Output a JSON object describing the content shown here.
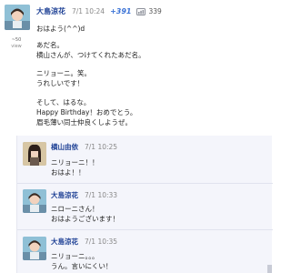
{
  "post": {
    "author": "大島涼花",
    "time": "7/1 10:24",
    "plus": "+391",
    "views": "339",
    "vote_count": "~50",
    "vote_label": "view",
    "lines": [
      "おはよう(^^)d",
      "",
      "あだ名。",
      "横山さんが、つけてくれたあだ名。",
      "",
      "ニリョーニ。笑。",
      "うれしいです！",
      "",
      "そして、はるな。",
      "Happy Birthday！おめでとう。",
      "眉毛薄い同士仲良くしようぜ。"
    ],
    "icon": "eye-icon"
  },
  "comments": [
    {
      "author": "横山由依",
      "time": "7/1 10:25",
      "lines": [
        "ニリョーニ！！",
        "おはよ！！"
      ],
      "avatar_color": "#d7c6a4"
    },
    {
      "author": "大島涼花",
      "time": "7/1 10:33",
      "lines": [
        "ニローニさん！",
        "おはようございます！"
      ],
      "avatar_color": "#9cc7da"
    },
    {
      "author": "大島涼花",
      "time": "7/1 10:35",
      "lines": [
        "ニリョーニ。。。",
        "うん。言いにくい！"
      ],
      "avatar_color": "#9cc7da"
    }
  ],
  "colors": {
    "author": "#1c3f94",
    "plus": "#3b73d6",
    "comment_bg": "#f4f5fb"
  }
}
